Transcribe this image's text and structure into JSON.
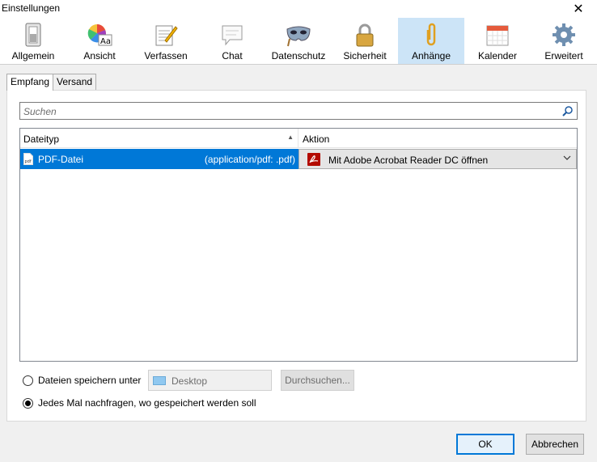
{
  "window": {
    "title": "Einstellungen"
  },
  "toolbar": {
    "items": [
      {
        "label": "Allgemein",
        "icon": "switch-icon"
      },
      {
        "label": "Ansicht",
        "icon": "color-wheel-icon"
      },
      {
        "label": "Verfassen",
        "icon": "notepad-pencil-icon"
      },
      {
        "label": "Chat",
        "icon": "speech-bubble-icon"
      },
      {
        "label": "Datenschutz",
        "icon": "mask-icon"
      },
      {
        "label": "Sicherheit",
        "icon": "padlock-icon"
      },
      {
        "label": "Anhänge",
        "icon": "paperclip-icon"
      },
      {
        "label": "Kalender",
        "icon": "calendar-icon"
      },
      {
        "label": "Erweitert",
        "icon": "gear-icon"
      }
    ],
    "selected": "Anhänge"
  },
  "tabs": [
    {
      "label": "Empfang"
    },
    {
      "label": "Versand"
    }
  ],
  "active_tab": "Empfang",
  "search": {
    "placeholder": "Suchen"
  },
  "table": {
    "headers": {
      "type": "Dateityp",
      "action": "Aktion"
    },
    "rows": [
      {
        "type": "PDF-Datei",
        "mime": "(application/pdf: .pdf)",
        "action": "Mit Adobe Acrobat Reader DC  öffnen"
      }
    ]
  },
  "save": {
    "option_save_to": "Dateien speichern unter",
    "folder": "Desktop",
    "browse": "Durchsuchen...",
    "option_ask": "Jedes Mal nachfragen, wo gespeichert werden soll",
    "selected_option": "ask"
  },
  "buttons": {
    "ok": "OK",
    "cancel": "Abbrechen"
  },
  "colors": {
    "selection": "#0078d7",
    "toolbar_selected": "#cce4f7",
    "accent_blue": "#0078d7"
  }
}
